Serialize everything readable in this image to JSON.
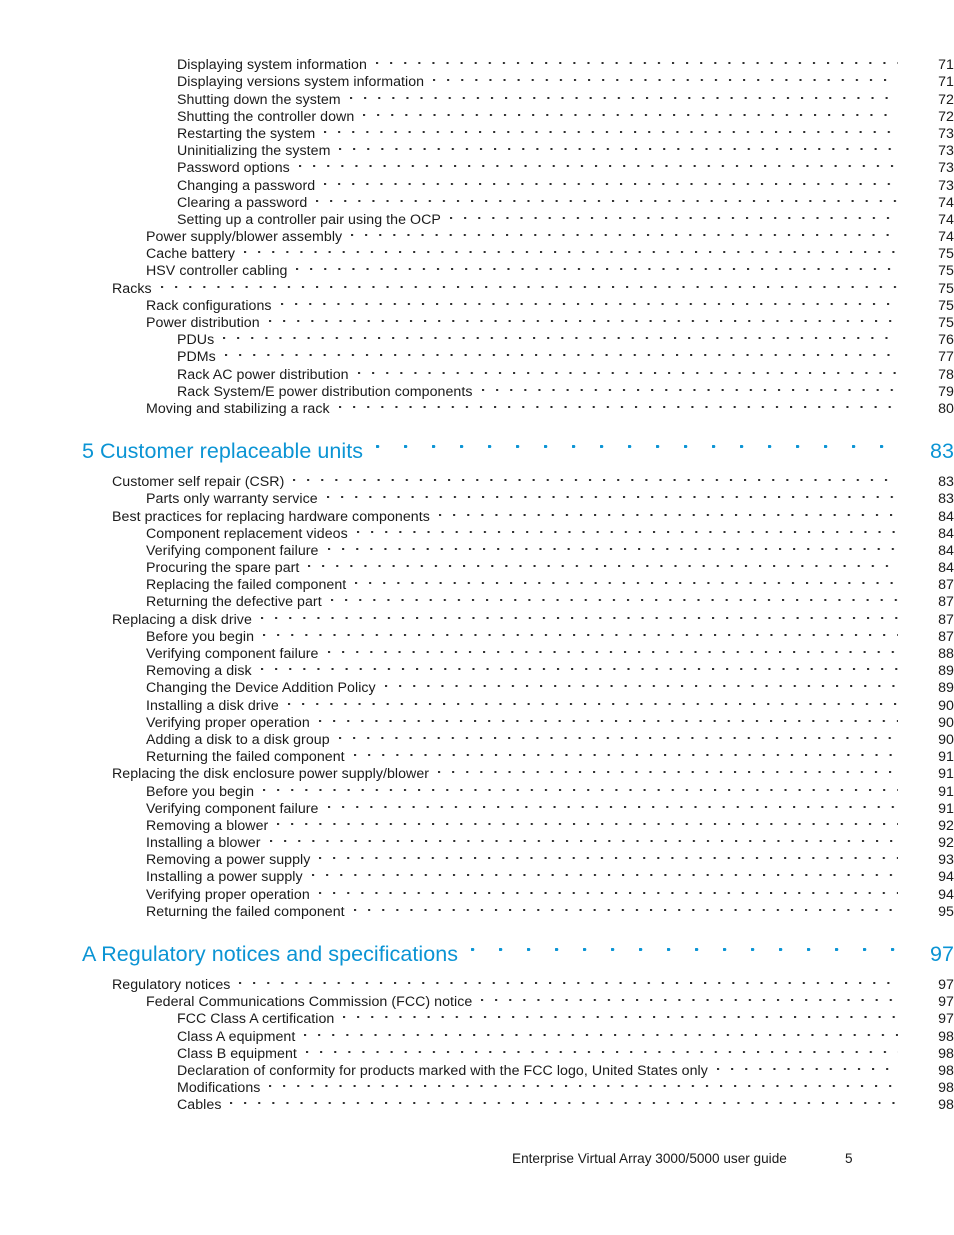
{
  "document": {
    "type": "table-of-contents",
    "footer": {
      "title": "Enterprise Virtual Array 3000/5000 user guide",
      "page_number": "5"
    },
    "accent_color": "#0b94d4",
    "text_color": "#1a1a1a"
  },
  "entries": [
    {
      "label": "Displaying system information",
      "page": "71",
      "level": 2,
      "kind": "entry"
    },
    {
      "label": "Displaying versions system information",
      "page": "71",
      "level": 2,
      "kind": "entry"
    },
    {
      "label": "Shutting down the system",
      "page": "72",
      "level": 2,
      "kind": "entry"
    },
    {
      "label": "Shutting the controller down",
      "page": "72",
      "level": 2,
      "kind": "entry"
    },
    {
      "label": "Restarting the system",
      "page": "73",
      "level": 2,
      "kind": "entry"
    },
    {
      "label": "Uninitializing the system",
      "page": "73",
      "level": 2,
      "kind": "entry"
    },
    {
      "label": "Password options",
      "page": "73",
      "level": 2,
      "kind": "entry"
    },
    {
      "label": "Changing a password",
      "page": "73",
      "level": 2,
      "kind": "entry"
    },
    {
      "label": "Clearing a password",
      "page": "74",
      "level": 2,
      "kind": "entry"
    },
    {
      "label": "Setting up a controller pair using the OCP",
      "page": "74",
      "level": 2,
      "kind": "entry"
    },
    {
      "label": "Power supply/blower assembly",
      "page": "74",
      "level": 1,
      "kind": "entry"
    },
    {
      "label": "Cache battery",
      "page": "75",
      "level": 1,
      "kind": "entry"
    },
    {
      "label": "HSV controller cabling",
      "page": "75",
      "level": 1,
      "kind": "entry"
    },
    {
      "label": "Racks",
      "page": "75",
      "level": 0,
      "kind": "entry"
    },
    {
      "label": "Rack configurations",
      "page": "75",
      "level": 1,
      "kind": "entry"
    },
    {
      "label": "Power distribution",
      "page": "75",
      "level": 1,
      "kind": "entry"
    },
    {
      "label": "PDUs",
      "page": "76",
      "level": 2,
      "kind": "entry"
    },
    {
      "label": "PDMs",
      "page": "77",
      "level": 2,
      "kind": "entry"
    },
    {
      "label": "Rack AC power distribution",
      "page": "78",
      "level": 2,
      "kind": "entry"
    },
    {
      "label": "Rack System/E power distribution components",
      "page": "79",
      "level": 2,
      "kind": "entry"
    },
    {
      "label": "Moving and stabilizing a rack",
      "page": "80",
      "level": 1,
      "kind": "entry"
    },
    {
      "label": "5 Customer replaceable units",
      "page": "83",
      "level": 0,
      "kind": "chapter"
    },
    {
      "label": "Customer self repair (CSR)",
      "page": "83",
      "level": 0,
      "kind": "entry"
    },
    {
      "label": "Parts only warranty service",
      "page": "83",
      "level": 1,
      "kind": "entry"
    },
    {
      "label": "Best practices for replacing hardware components",
      "page": "84",
      "level": 0,
      "kind": "entry"
    },
    {
      "label": "Component replacement videos",
      "page": "84",
      "level": 1,
      "kind": "entry"
    },
    {
      "label": "Verifying component failure",
      "page": "84",
      "level": 1,
      "kind": "entry"
    },
    {
      "label": "Procuring the spare part",
      "page": "84",
      "level": 1,
      "kind": "entry"
    },
    {
      "label": "Replacing the failed component",
      "page": "87",
      "level": 1,
      "kind": "entry"
    },
    {
      "label": "Returning the defective part",
      "page": "87",
      "level": 1,
      "kind": "entry"
    },
    {
      "label": "Replacing a disk drive",
      "page": "87",
      "level": 0,
      "kind": "entry"
    },
    {
      "label": "Before you begin",
      "page": "87",
      "level": 1,
      "kind": "entry"
    },
    {
      "label": "Verifying component failure",
      "page": "88",
      "level": 1,
      "kind": "entry"
    },
    {
      "label": "Removing a disk",
      "page": "89",
      "level": 1,
      "kind": "entry"
    },
    {
      "label": "Changing the Device Addition Policy",
      "page": "89",
      "level": 1,
      "kind": "entry"
    },
    {
      "label": "Installing a disk drive",
      "page": "90",
      "level": 1,
      "kind": "entry"
    },
    {
      "label": "Verifying proper operation",
      "page": "90",
      "level": 1,
      "kind": "entry"
    },
    {
      "label": "Adding a disk to a disk group",
      "page": "90",
      "level": 1,
      "kind": "entry"
    },
    {
      "label": "Returning the failed component",
      "page": "91",
      "level": 1,
      "kind": "entry"
    },
    {
      "label": "Replacing the disk enclosure power supply/blower",
      "page": "91",
      "level": 0,
      "kind": "entry"
    },
    {
      "label": "Before you begin",
      "page": "91",
      "level": 1,
      "kind": "entry"
    },
    {
      "label": "Verifying component failure",
      "page": "91",
      "level": 1,
      "kind": "entry"
    },
    {
      "label": "Removing a blower",
      "page": "92",
      "level": 1,
      "kind": "entry"
    },
    {
      "label": "Installing a blower",
      "page": "92",
      "level": 1,
      "kind": "entry"
    },
    {
      "label": "Removing a power supply",
      "page": "93",
      "level": 1,
      "kind": "entry"
    },
    {
      "label": "Installing a power supply",
      "page": "94",
      "level": 1,
      "kind": "entry"
    },
    {
      "label": "Verifying proper operation",
      "page": "94",
      "level": 1,
      "kind": "entry"
    },
    {
      "label": "Returning the failed component",
      "page": "95",
      "level": 1,
      "kind": "entry"
    },
    {
      "label": "A Regulatory notices and specifications",
      "page": "97",
      "level": 0,
      "kind": "chapter"
    },
    {
      "label": "Regulatory notices",
      "page": "97",
      "level": 0,
      "kind": "entry"
    },
    {
      "label": "Federal Communications Commission (FCC) notice",
      "page": "97",
      "level": 1,
      "kind": "entry"
    },
    {
      "label": "FCC Class A certification",
      "page": "97",
      "level": 2,
      "kind": "entry"
    },
    {
      "label": "Class A equipment",
      "page": "98",
      "level": 2,
      "kind": "entry"
    },
    {
      "label": "Class B equipment",
      "page": "98",
      "level": 2,
      "kind": "entry"
    },
    {
      "label": "Declaration of conformity for products marked with the FCC logo, United States only",
      "page": "98",
      "level": 2,
      "kind": "entry"
    },
    {
      "label": "Modifications",
      "page": "98",
      "level": 2,
      "kind": "entry"
    },
    {
      "label": "Cables",
      "page": "98",
      "level": 2,
      "kind": "entry"
    }
  ]
}
